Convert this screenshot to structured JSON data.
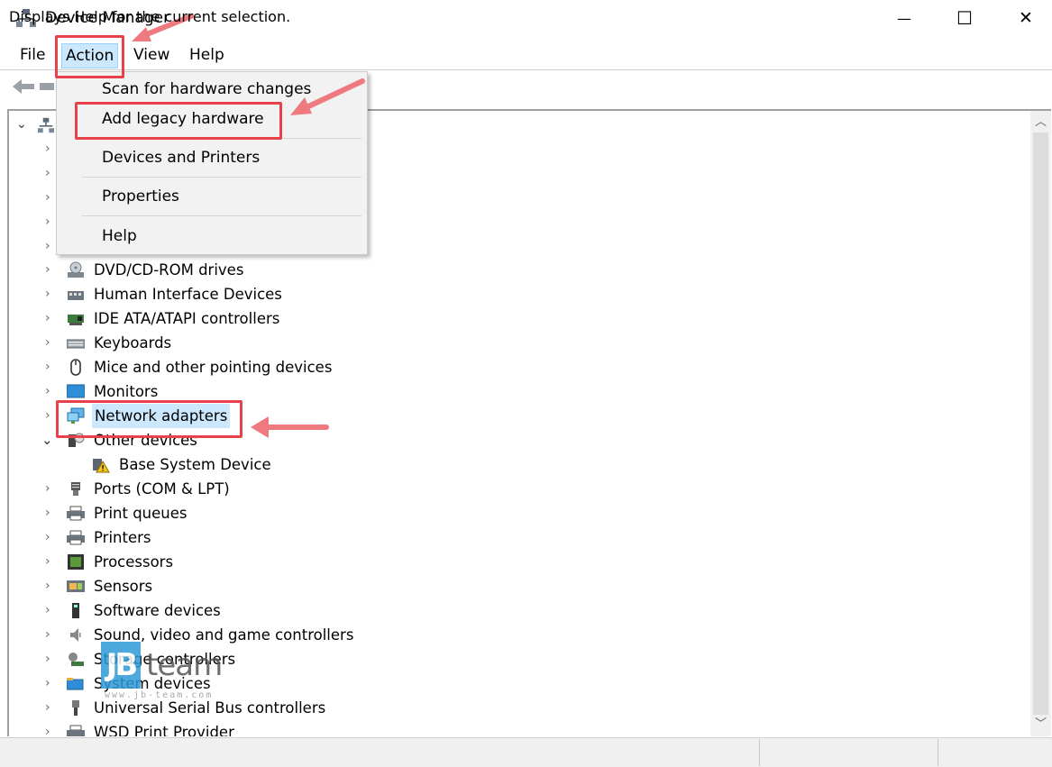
{
  "window": {
    "title": "Device Manager",
    "minimize_glyph": "—",
    "maximize_glyph": "☐",
    "close_glyph": "✕"
  },
  "menu": {
    "file": "File",
    "action": "Action",
    "view": "View",
    "help": "Help"
  },
  "action_menu": {
    "items": [
      {
        "label": "Scan for hardware changes"
      },
      {
        "label": "Add legacy hardware"
      },
      {
        "label": "Devices and Printers"
      },
      {
        "label": "Properties"
      },
      {
        "label": "Help"
      }
    ]
  },
  "tree": {
    "categories": [
      {
        "label": "DVD/CD-ROM drives",
        "icon": "dvd-drive-icon"
      },
      {
        "label": "Human Interface Devices",
        "icon": "hid-icon"
      },
      {
        "label": "IDE ATA/ATAPI controllers",
        "icon": "ide-controller-icon"
      },
      {
        "label": "Keyboards",
        "icon": "keyboard-icon"
      },
      {
        "label": "Mice and other pointing devices",
        "icon": "mouse-icon"
      },
      {
        "label": "Monitors",
        "icon": "monitor-icon"
      },
      {
        "label": "Network adapters",
        "icon": "network-adapter-icon"
      },
      {
        "label": "Other devices",
        "icon": "other-devices-icon"
      },
      {
        "label": "Base System Device",
        "icon": "warning-device-icon"
      },
      {
        "label": "Ports (COM & LPT)",
        "icon": "port-icon"
      },
      {
        "label": "Print queues",
        "icon": "printer-icon"
      },
      {
        "label": "Printers",
        "icon": "printer-icon"
      },
      {
        "label": "Processors",
        "icon": "processor-icon"
      },
      {
        "label": "Sensors",
        "icon": "sensor-icon"
      },
      {
        "label": "Software devices",
        "icon": "software-device-icon"
      },
      {
        "label": "Sound, video and game controllers",
        "icon": "speaker-icon"
      },
      {
        "label": "Storage controllers",
        "icon": "storage-controller-icon"
      },
      {
        "label": "System devices",
        "icon": "system-devices-icon"
      },
      {
        "label": "Universal Serial Bus controllers",
        "icon": "usb-icon"
      },
      {
        "label": "WSD Print Provider",
        "icon": "printer-icon"
      }
    ]
  },
  "status": {
    "text": "Displays Help for the current selection."
  },
  "watermark": {
    "brand": "JBteam",
    "url": "www.jb-team.com"
  },
  "colors": {
    "annotation_red": "#e8414b",
    "selection_blue": "#cce8ff"
  }
}
